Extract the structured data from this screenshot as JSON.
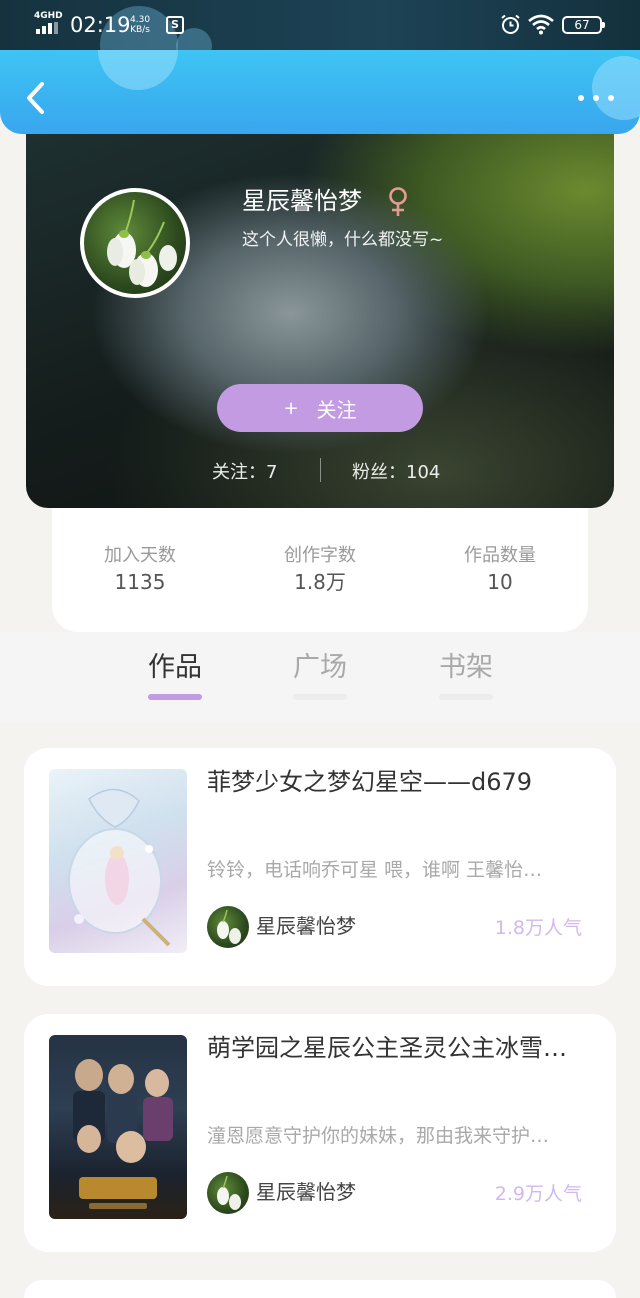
{
  "status_bar": {
    "network": "4GHD",
    "time": "02:19",
    "speed_value": "4.30",
    "speed_unit": "KB/s",
    "app_icon_letter": "S",
    "battery": "67"
  },
  "header": {
    "back_icon": "chevron-left-icon",
    "more_icon": "more-horizontal-icon"
  },
  "profile": {
    "nickname": "星辰馨怡梦",
    "gender": "female",
    "signature": "这个人很懒，什么都没写~",
    "follow_plus": "+",
    "follow_label": "关注",
    "following_label": "关注：",
    "following_count": "7",
    "fans_label": "粉丝：",
    "fans_count": "104"
  },
  "stats": [
    {
      "label": "加入天数",
      "value": "1135"
    },
    {
      "label": "创作字数",
      "value": "1.8万"
    },
    {
      "label": "作品数量",
      "value": "10"
    }
  ],
  "tabs": [
    {
      "label": "作品",
      "active": true
    },
    {
      "label": "广场",
      "active": false
    },
    {
      "label": "书架",
      "active": false
    }
  ],
  "works": [
    {
      "title": "菲梦少女之梦幻星空——d679",
      "excerpt": "铃铃，电话响乔可星 喂，谁啊 王馨怡…",
      "author": "星辰馨怡梦",
      "popularity": "1.8万人气"
    },
    {
      "title": "萌学园之星辰公主圣灵公主冰雪…",
      "excerpt": "潼恩愿意守护你的妹妹，那由我来守护…",
      "author": "星辰馨怡梦",
      "popularity": "2.9万人气"
    }
  ],
  "colors": {
    "accent": "#c39be3",
    "header": "#3ab2f0",
    "popularity": "#d2b8ee"
  }
}
